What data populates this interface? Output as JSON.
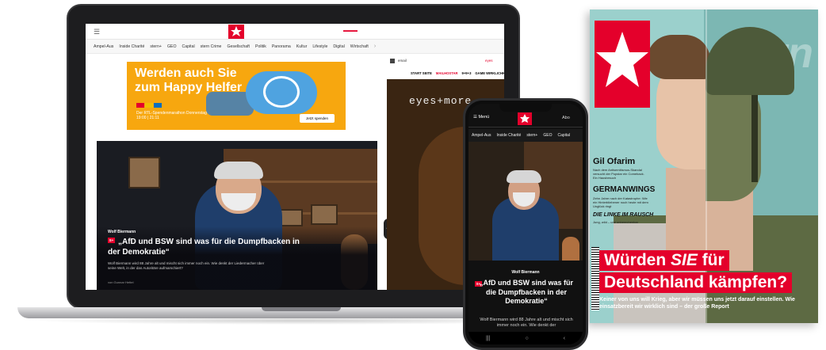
{
  "laptop": {
    "nav_items": [
      "Ampel-Aus",
      "Inside Charité",
      "stern+",
      "GEO",
      "Capital",
      "stern Crime",
      "Gesellschaft",
      "Politik",
      "Panorama",
      "Kultur",
      "Lifestyle",
      "Digital",
      "Wirtschaft"
    ],
    "nav_more": "›",
    "ad": {
      "title": "Werden auch Sie zum Happy Helfer",
      "subtitle": "Der RTL-Spendenmarathon Donnerstag 19:00 | 21:11",
      "button": "Jetzt spenden"
    },
    "hero": {
      "kicker": "Wolf Biermann",
      "plus_badge": "S+",
      "headline": "„AfD und BSW sind was für die Dumpfbacken in der Demokratie“",
      "teaser": "Wolf Biermann wird 88 Jahre alt und mischt sich immer noch ein. Wie denkt der Liedermacher über seine Welt, in der das Autoritäre aufmarschiert?",
      "author": "von Gunnar Hettel"
    },
    "sidebar": {
      "mail": "email",
      "eyes": "eyes",
      "tabs": [
        "START SEITE",
        "MAILHOSTAR",
        "9+9+3",
        "GAME WIRKLICHKEIT"
      ],
      "brand": "eyes+more"
    }
  },
  "phone": {
    "menu": "Menü",
    "abo": "Abo",
    "nav_items": [
      "Ampel-Aus",
      "Inside Charité",
      "stern+",
      "GEO",
      "Capital"
    ],
    "kicker": "Wolf Biermann",
    "plus_badge": "S+",
    "headline": "„AfD und BSW sind was für die Dumpfbacken in der Demokratie“",
    "teaser": "Wolf Biermann wird 88 Jahre alt und mischt sich immer noch ein. Wie denkt der",
    "bottom_icons": [
      "|||",
      "○",
      "‹"
    ]
  },
  "magazine": {
    "masthead": "stern",
    "stories": [
      {
        "kicker": "Gil Ofarim",
        "sub": "Nach dem Antisemitismus-Skandal versucht der Popstar ein Comeback. Ein Hausbesuch"
      },
      {
        "kicker": "GERMANWINGS",
        "sub": "Zehn Jahre nach der Katastrophe: Wie ein Hinterbliebener noch heute mit dem Unglück ringt"
      },
      {
        "kicker": "DIE LINKE IM RAUSCH",
        "sub": "Jung, wild – und unberechenbar"
      }
    ],
    "title_line1_pre": "Würden ",
    "title_line1_em": "SIE",
    "title_line1_post": " für",
    "title_line2": "Deutschland kämpfen?",
    "dek": "Keiner von uns will Krieg, aber wir müssen uns jetzt darauf einstellen. Wie einsatzbereit wir wirklich sind – der große Report",
    "colors": {
      "brand_red": "#e4002b",
      "cover_teal": "#9bd0cc"
    }
  }
}
